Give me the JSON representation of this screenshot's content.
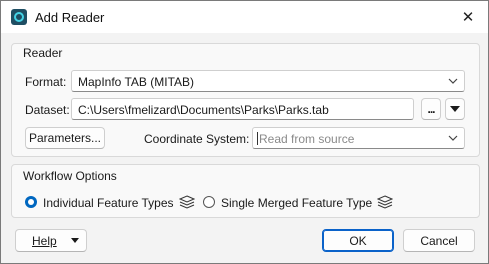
{
  "window": {
    "title": "Add Reader",
    "close_glyph": "✕"
  },
  "reader": {
    "group_title": "Reader",
    "format_label": "Format:",
    "format_value": "MapInfo TAB (MITAB)",
    "dataset_label": "Dataset:",
    "dataset_value": "C:\\Users\\fmelizard\\Documents\\Parks\\Parks.tab",
    "browse_label": "...",
    "parameters_label": "Parameters...",
    "coord_label": "Coordinate System:",
    "coord_placeholder": "Read from source"
  },
  "workflow": {
    "group_title": "Workflow Options",
    "option1": "Individual Feature Types",
    "option2": "Single Merged Feature Type",
    "selected": "Individual Feature Types"
  },
  "footer": {
    "help_label": "Help",
    "ok_label": "OK",
    "cancel_label": "Cancel"
  },
  "colors": {
    "accent": "#0067c0",
    "ok_border": "#0a62c9"
  }
}
